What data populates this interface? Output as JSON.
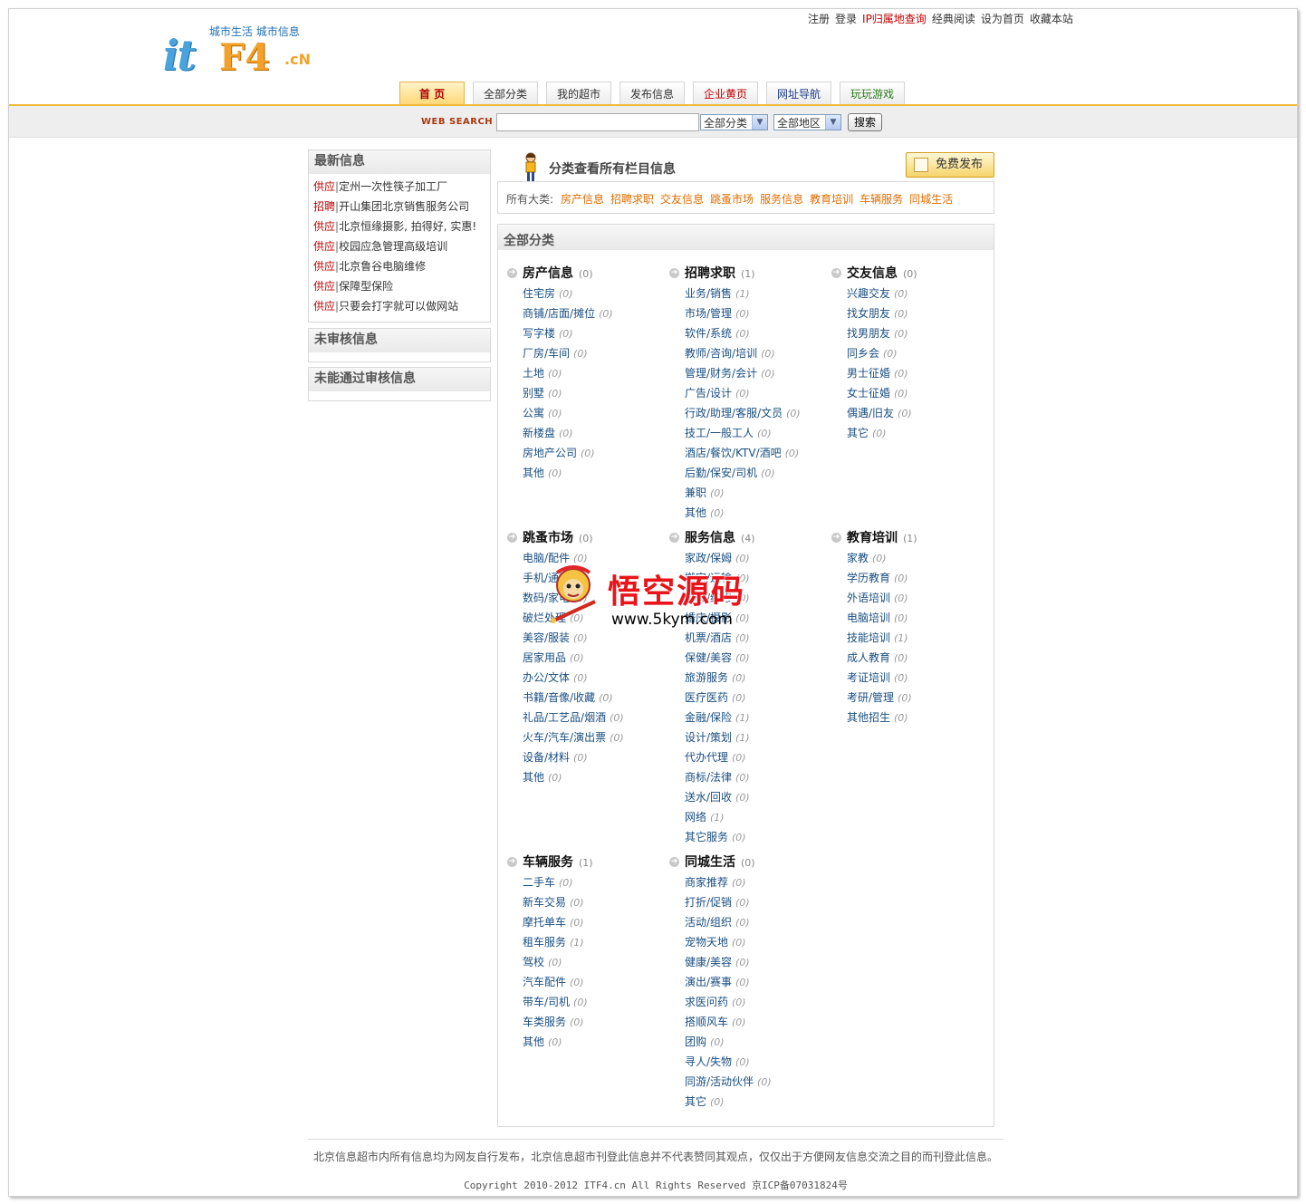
{
  "header": {
    "top_links": [
      {
        "label": "注册",
        "red": false
      },
      {
        "label": "登录",
        "red": false
      },
      {
        "label": "IP归属地查询",
        "red": true
      },
      {
        "label": "经典阅读",
        "red": false
      },
      {
        "label": "设为首页",
        "red": false
      },
      {
        "label": "收藏本站",
        "red": false
      }
    ],
    "logo": {
      "it": "it",
      "f4": "F4",
      "cn": ".cN",
      "slogan": "城市生活 城市信息"
    },
    "tabs": [
      "首 页",
      "全部分类",
      "我的超市",
      "发布信息",
      "企业黄页",
      "网址导航",
      "玩玩游戏"
    ]
  },
  "search": {
    "label": "WEB SEARCH",
    "value": "",
    "category_select": "全部分类",
    "area_select": "全部地区",
    "button": "搜索"
  },
  "sidebar": {
    "latest_title": "最新信息",
    "latest": [
      {
        "tag": "供应",
        "text": "定州一次性筷子加工厂"
      },
      {
        "tag": "招聘",
        "text": "开山集团北京销售服务公司"
      },
      {
        "tag": "供应",
        "text": "北京恒缘摄影, 拍得好, 实惠!"
      },
      {
        "tag": "供应",
        "text": "校园应急管理高级培训"
      },
      {
        "tag": "供应",
        "text": "北京鲁谷电脑维修"
      },
      {
        "tag": "供应",
        "text": "保障型保险"
      },
      {
        "tag": "供应",
        "text": "只要会打字就可以做网站"
      }
    ],
    "unreviewed_title": "未审核信息",
    "rejected_title": "未能通过审核信息"
  },
  "main": {
    "heading": "分类查看所有栏目信息",
    "publish_button": "免费发布",
    "all_categories_label": "所有大类:",
    "top_categories": [
      "房产信息",
      "招聘求职",
      "交友信息",
      "跳蚤市场",
      "服务信息",
      "教育培训",
      "车辆服务",
      "同城生活"
    ],
    "all_title": "全部分类",
    "categories": [
      {
        "name": "房产信息",
        "count": "(0)",
        "items": [
          {
            "n": "住宅房",
            "c": "(0)"
          },
          {
            "n": "商铺/店面/摊位",
            "c": "(0)"
          },
          {
            "n": "写字楼",
            "c": "(0)"
          },
          {
            "n": "厂房/车间",
            "c": "(0)"
          },
          {
            "n": "土地",
            "c": "(0)"
          },
          {
            "n": "别墅",
            "c": "(0)"
          },
          {
            "n": "公寓",
            "c": "(0)"
          },
          {
            "n": "新楼盘",
            "c": "(0)"
          },
          {
            "n": "房地产公司",
            "c": "(0)"
          },
          {
            "n": "其他",
            "c": "(0)"
          }
        ]
      },
      {
        "name": "招聘求职",
        "count": "(1)",
        "items": [
          {
            "n": "业务/销售",
            "c": "(1)"
          },
          {
            "n": "市场/管理",
            "c": "(0)"
          },
          {
            "n": "软件/系统",
            "c": "(0)"
          },
          {
            "n": "教师/咨询/培训",
            "c": "(0)"
          },
          {
            "n": "管理/财务/会计",
            "c": "(0)"
          },
          {
            "n": "广告/设计",
            "c": "(0)"
          },
          {
            "n": "行政/助理/客服/文员",
            "c": "(0)"
          },
          {
            "n": "技工/一般工人",
            "c": "(0)"
          },
          {
            "n": "酒店/餐饮/KTV/酒吧",
            "c": "(0)"
          },
          {
            "n": "后勤/保安/司机",
            "c": "(0)"
          },
          {
            "n": "兼职",
            "c": "(0)"
          },
          {
            "n": "其他",
            "c": "(0)"
          }
        ]
      },
      {
        "name": "交友信息",
        "count": "(0)",
        "items": [
          {
            "n": "兴趣交友",
            "c": "(0)"
          },
          {
            "n": "找女朋友",
            "c": "(0)"
          },
          {
            "n": "找男朋友",
            "c": "(0)"
          },
          {
            "n": "同乡会",
            "c": "(0)"
          },
          {
            "n": "男士征婚",
            "c": "(0)"
          },
          {
            "n": "女士征婚",
            "c": "(0)"
          },
          {
            "n": "偶遇/旧友",
            "c": "(0)"
          },
          {
            "n": "其它",
            "c": "(0)"
          }
        ]
      },
      {
        "name": "跳蚤市场",
        "count": "(0)",
        "items": [
          {
            "n": "电脑/配件",
            "c": "(0)"
          },
          {
            "n": "手机/通讯",
            "c": "(0)"
          },
          {
            "n": "数码/家电",
            "c": "(0)"
          },
          {
            "n": "破烂处理",
            "c": "(0)"
          },
          {
            "n": "美容/服装",
            "c": "(0)"
          },
          {
            "n": "居家用品",
            "c": "(0)"
          },
          {
            "n": "办公/文体",
            "c": "(0)"
          },
          {
            "n": "书籍/音像/收藏",
            "c": "(0)"
          },
          {
            "n": "礼品/工艺品/烟酒",
            "c": "(0)"
          },
          {
            "n": "火车/汽车/演出票",
            "c": "(0)"
          },
          {
            "n": "设备/材料",
            "c": "(0)"
          },
          {
            "n": "其他",
            "c": "(0)"
          }
        ]
      },
      {
        "name": "服务信息",
        "count": "(4)",
        "items": [
          {
            "n": "家政/保姆",
            "c": "(0)"
          },
          {
            "n": "搬家/运输",
            "c": "(0)"
          },
          {
            "n": "装修/维修",
            "c": "(0)"
          },
          {
            "n": "婚庆/摄影",
            "c": "(0)"
          },
          {
            "n": "机票/酒店",
            "c": "(0)"
          },
          {
            "n": "保健/美容",
            "c": "(0)"
          },
          {
            "n": "旅游服务",
            "c": "(0)"
          },
          {
            "n": "医疗医药",
            "c": "(0)"
          },
          {
            "n": "金融/保险",
            "c": "(1)"
          },
          {
            "n": "设计/策划",
            "c": "(1)"
          },
          {
            "n": "代办代理",
            "c": "(0)"
          },
          {
            "n": "商标/法律",
            "c": "(0)"
          },
          {
            "n": "送水/回收",
            "c": "(0)"
          },
          {
            "n": "网络",
            "c": "(1)"
          },
          {
            "n": "其它服务",
            "c": "(0)"
          }
        ]
      },
      {
        "name": "教育培训",
        "count": "(1)",
        "items": [
          {
            "n": "家教",
            "c": "(0)"
          },
          {
            "n": "学历教育",
            "c": "(0)"
          },
          {
            "n": "外语培训",
            "c": "(0)"
          },
          {
            "n": "电脑培训",
            "c": "(0)"
          },
          {
            "n": "技能培训",
            "c": "(1)"
          },
          {
            "n": "成人教育",
            "c": "(0)"
          },
          {
            "n": "考证培训",
            "c": "(0)"
          },
          {
            "n": "考研/管理",
            "c": "(0)"
          },
          {
            "n": "其他招生",
            "c": "(0)"
          }
        ]
      },
      {
        "name": "车辆服务",
        "count": "(1)",
        "items": [
          {
            "n": "二手车",
            "c": "(0)"
          },
          {
            "n": "新车交易",
            "c": "(0)"
          },
          {
            "n": "摩托单车",
            "c": "(0)"
          },
          {
            "n": "租车服务",
            "c": "(1)"
          },
          {
            "n": "驾校",
            "c": "(0)"
          },
          {
            "n": "汽车配件",
            "c": "(0)"
          },
          {
            "n": "带车/司机",
            "c": "(0)"
          },
          {
            "n": "车类服务",
            "c": "(0)"
          },
          {
            "n": "其他",
            "c": "(0)"
          }
        ]
      },
      {
        "name": "同城生活",
        "count": "(0)",
        "items": [
          {
            "n": "商家推荐",
            "c": "(0)"
          },
          {
            "n": "打折/促销",
            "c": "(0)"
          },
          {
            "n": "活动/组织",
            "c": "(0)"
          },
          {
            "n": "宠物天地",
            "c": "(0)"
          },
          {
            "n": "健康/美容",
            "c": "(0)"
          },
          {
            "n": "演出/赛事",
            "c": "(0)"
          },
          {
            "n": "求医问药",
            "c": "(0)"
          },
          {
            "n": "搭顺风车",
            "c": "(0)"
          },
          {
            "n": "团购",
            "c": "(0)"
          },
          {
            "n": "寻人/失物",
            "c": "(0)"
          },
          {
            "n": "同游/活动伙伴",
            "c": "(0)"
          },
          {
            "n": "其它",
            "c": "(0)"
          }
        ]
      }
    ]
  },
  "footer": {
    "disclaimer": "北京信息超市内所有信息均为网友自行发布，北京信息超市刊登此信息并不代表赞同其观点，仅仅出于方便网友信息交流之目的而刊登此信息。",
    "copyright": "Copyright 2010-2012 ITF4.cn All Rights Reserved 京ICP备07031824号"
  },
  "watermark": {
    "title": "悟空源码",
    "url": "www.5kym.com"
  }
}
